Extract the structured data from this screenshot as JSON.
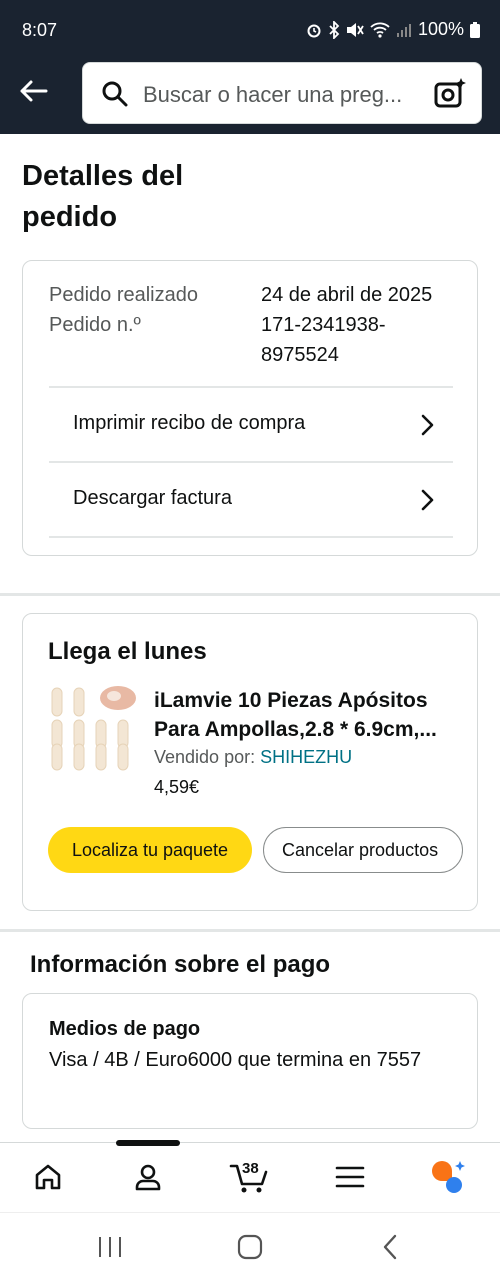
{
  "status": {
    "time": "8:07",
    "battery": "100%"
  },
  "header": {
    "search_placeholder": "Buscar o hacer una preg..."
  },
  "page": {
    "title": "Detalles del pedido"
  },
  "order": {
    "placed_label": "Pedido realizado",
    "placed_date": "24 de abril de 2025",
    "number_label": "Pedido n.º",
    "number_line1": "171-2341938-",
    "number_line2": "8975524",
    "links": [
      "Imprimir recibo de compra",
      "Descargar factura"
    ]
  },
  "delivery": {
    "title": "Llega el lunes",
    "product_title_line1": "iLamvie 10 Piezas Apósitos",
    "product_title_line2": "Para Ampollas,2.8 * 6.9cm,...",
    "seller_label": "Vendido por:",
    "seller_name": "SHIHEZHU",
    "price": "4,59€",
    "btn_track": "Localiza tu paquete",
    "btn_cancel": "Cancelar productos"
  },
  "payment": {
    "section_title": "Información sobre el pago",
    "method_label": "Medios de pago",
    "method_value": "Visa / 4B / Euro6000  que termina en 7557"
  },
  "nav": {
    "cart_count": "38",
    "items": [
      "home-icon",
      "account-icon",
      "cart-icon",
      "menu-icon",
      "rufus-icon"
    ]
  },
  "colors": {
    "header_bg": "#1a2330",
    "button_yellow": "#ffd814",
    "link_teal": "#007185"
  }
}
